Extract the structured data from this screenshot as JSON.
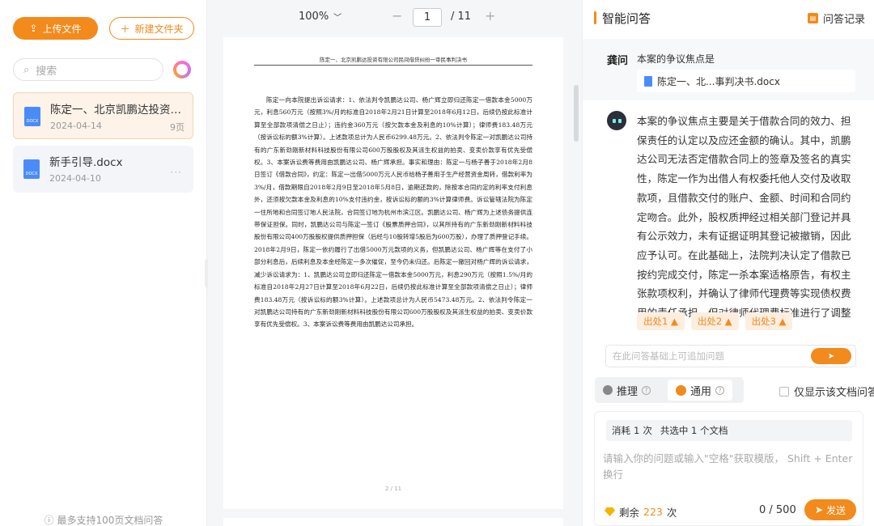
{
  "sidebar": {
    "upload_label": "上传文件",
    "new_folder_label": "新建文件夹",
    "search_placeholder": "搜索",
    "files": [
      {
        "name": "陈定一、北京凯鹏达投资有...",
        "date": "2024-04-14",
        "pages": "9页",
        "type": "DOCX"
      },
      {
        "name": "新手引导.docx",
        "date": "2024-04-10",
        "more": "···",
        "type": "DOCX"
      }
    ],
    "note": "最多支持100页文档问答"
  },
  "viewer": {
    "zoom": "100%",
    "page_current": "1",
    "page_total": "/ 11",
    "page_header": "陈定一、北京凯鹏达投资有限公司民间借贷纠纷一审民事判决书",
    "page_footer": "2 / 11",
    "page_body": "陈定一向本院提出诉讼请求：1、依法判令凯鹏达公司、杨广辉立即归还陈定一借款本金5000万元，利息560万元（按照3%/月的标准自2018年2月21日计算至2018年6月12日，后续仍按此标准计算至全部款项清偿之日止）；违约金360万元（按欠款本金及利息的10%计算）；律师费183.48万元（按诉讼标的额3%计算）。上述款项总计为人民币6299.48万元。2、依法判令陈定一对凯鹏达公司持有的广东新劲刚新材料科技股份有限公司600万股股权及其派生权益的拍卖、变卖价款享有优先受偿权。3、本案诉讼费等费用由凯鹏达公司、杨广辉承担。事实和理由：陈定一与杨子善于2018年2月8日签订《借款合同》，约定：陈定一出借5000万元人民币给杨子善用于生产经营资金周转，借款利率为3%/月，借款期限自2018年2月9日至2018年5月8日，逾期还款的，除按本合同约定的利率支付利息外，还须按欠款本金及利息的10%支付违约金，按诉讼标的额的3%计算律师费。诉讼管辖法院为陈定一住所地和合同签订地人民法院，合同签订地为杭州市滨江区。凯鹏达公司、杨广辉为上述债务提供连带保证担保。同时，凯鹏达公司与陈定一签订《股票质押合同》，以其所持有的广东新劲刚新材料科技股份有限公司400万股股权提供质押担保（后经与10股转增5股后为600万股），办理了质押登记手续。2018年2月9日，陈定一依约履行了出借5000万元款项的义务，但凯鹏达公司、杨广辉等在支付了小部分利息后，后续利息及本金经陈定一多次催促，至今仍未归还。后陈定一撤回对杨广辉的诉讼请求，减少诉讼请求为：1、凯鹏达公司立即归还陈定一借款本金5000万元，利息290万元（按照1.5%/月的标准自2018年2月27日计算至2018年6月22日，后续仍按此标准计算至全部款项清偿之日止）；律师费183.48万元（按诉讼标的额3%计算）。上述款项总计为人民币5473.48万元。2、依法判令陈定一对凯鹏达公司持有的广东新劲刚新材料科技股份有限公司600万股股权及其派生权益的拍卖、变卖价款享有优先受偿权。3、本案诉讼费等费用由凯鹏达公司承担。"
  },
  "panel": {
    "title": "智能问答",
    "history_label": "问答记录",
    "question": {
      "user": "龚问",
      "text": "本案的争议焦点是",
      "doc": "陈定一、北...事判决书.docx"
    },
    "answer": "本案的争议焦点主要是关于借款合同的效力、担保责任的认定以及应还金额的确认。其中，凯鹏达公司无法否定借款合同上的签章及签名的真实性，陈定一作为出借人有权委托他人交付及收取款项，且借款交付的账户、金额、时间和合同约定吻合。此外，股权质押经过相关部门登记并具有公示效力，未有证据证明其登记被撤销，因此应予认可。在此基础上，法院判决认定了借款已按约完成交付，陈定一杀本案适格原告，有权主张款项权利，并确认了律师代理费等实现债权费用的责任承担，但对律师代理费标准进行了调整",
    "sources": [
      "出处1 ▲",
      "出处2 ▲",
      "出处3 ▲"
    ],
    "followup_placeholder": "在此问答基础上可追加问题",
    "modes": {
      "reasoning": "推理",
      "general": "通用",
      "hint": "?"
    },
    "only_doc_label": "仅显示该文档问答",
    "consume": {
      "label": "消耗",
      "count": "1",
      "unit": "次",
      "selected": "共选中 1 个文档"
    },
    "prompt_placeholder": "请输入你的问题或输入\"空格\"获取模版， Shift + Enter 换行",
    "remain": {
      "label": "剩余",
      "count": "223",
      "unit": "次"
    },
    "counter": "0 / 500",
    "send_label": "发送"
  },
  "colors": {
    "accent": "#f28a1c",
    "docx": "#4a8cf7"
  }
}
